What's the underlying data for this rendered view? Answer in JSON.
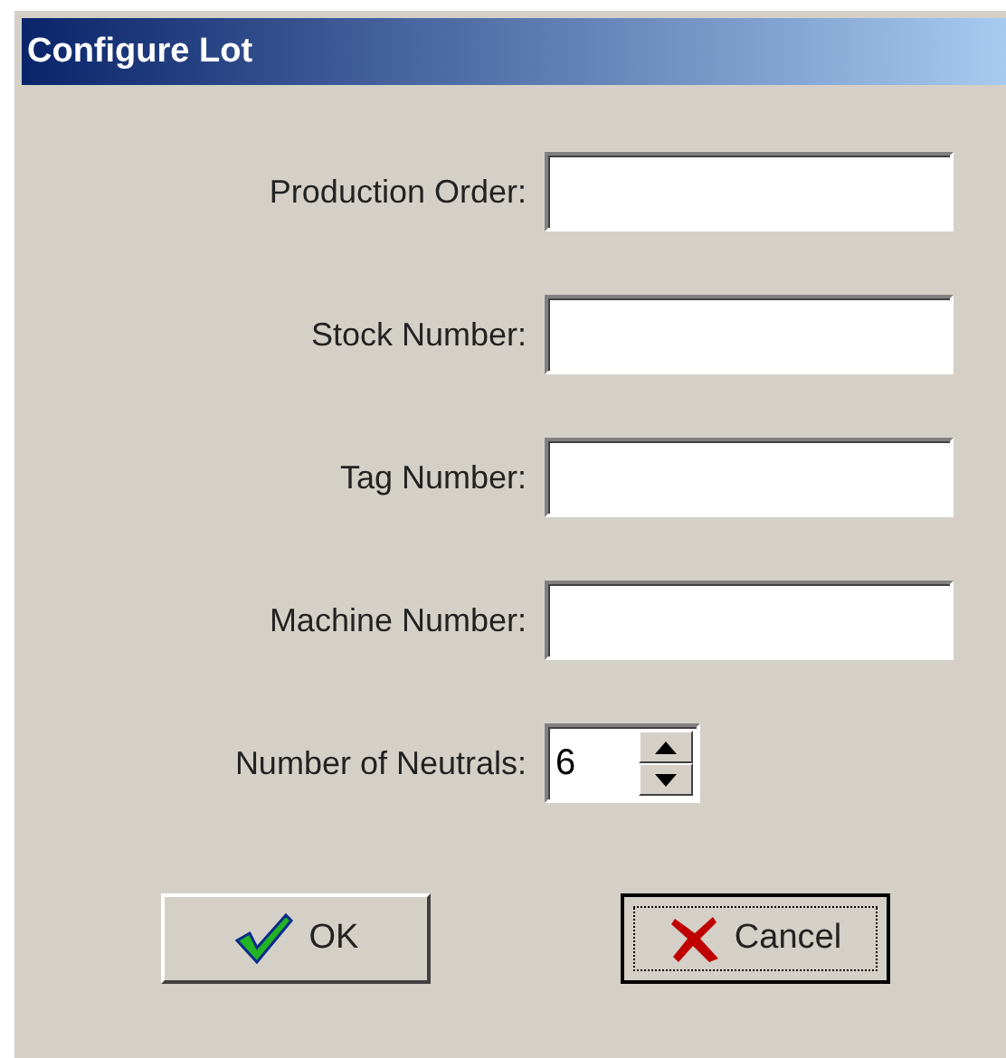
{
  "window": {
    "title": "Configure Lot"
  },
  "fields": [
    {
      "label": "Production Order:"
    },
    {
      "label": "Stock Number:"
    },
    {
      "label": "Tag Number:"
    },
    {
      "label": "Machine Number:"
    }
  ],
  "spinner": {
    "label": "Number of Neutrals:",
    "value": "6"
  },
  "buttons": [
    {
      "kind": "ok",
      "label": "OK",
      "focused": false
    },
    {
      "kind": "cancel",
      "label": "Cancel",
      "focused": true
    }
  ]
}
